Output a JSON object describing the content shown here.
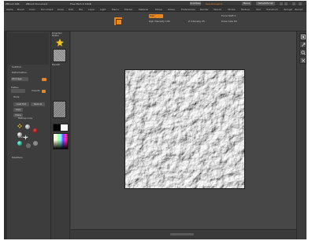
{
  "titlebar": {
    "app": "ZBrush 4R6",
    "doc": "ZBrush Document",
    "mem": "Free Mem 4.74GB",
    "quick": "QuickSave",
    "seethrough": "See-through 0",
    "menus": "Menus",
    "script": "DefaultZScript"
  },
  "menubar": {
    "items": [
      "Alpha",
      "Brush",
      "Color",
      "Document",
      "Draw",
      "Edit",
      "File",
      "Layer",
      "Light",
      "Macro",
      "Marker",
      "Material",
      "Movie",
      "Picker",
      "Preferences",
      "Render",
      "Stencil",
      "Stroke",
      "Texture",
      "Tool",
      "Transform",
      "Zplugin",
      "Zscript"
    ]
  },
  "shelf": {
    "rgb": "Rgb",
    "rgb_intensity": "Rgb Intensity 100",
    "z_intensity": "Z Intensity 25",
    "focal_shift": "Focal Shift 0",
    "draw_size": "Draw Size 64"
  },
  "leftpanel": {
    "header1": "SubTool",
    "header2": "Deformation",
    "dropdown": "2D Image",
    "label1": "Flatten",
    "label2": "Smooth",
    "header3": "Tools",
    "btn_load": "Load Tool",
    "btn_save": "Save As",
    "btn_copy": "Copy",
    "btn_clone": "Clone",
    "label_mat": "MatCap Gray",
    "label_gradient": "Gradient",
    "header4": "Modifiers"
  },
  "col2": {
    "projection": "Projection Master",
    "thumb_label": "Plane3D"
  },
  "righttray": {
    "icons": [
      "bpr-icon",
      "scroll-icon",
      "zoom-icon",
      "actual-icon"
    ]
  },
  "colors": {
    "accent": "#e8891f",
    "ui_bg": "#3b3b3b",
    "viewport": "#474747"
  }
}
